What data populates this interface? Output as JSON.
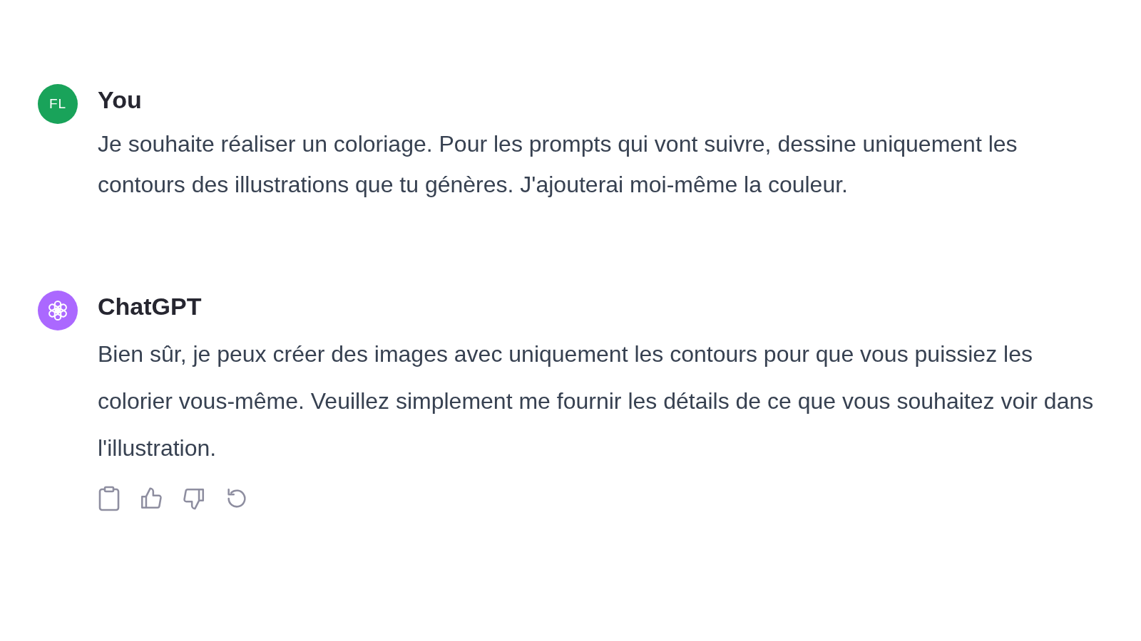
{
  "messages": [
    {
      "kind": "user",
      "author": "You",
      "avatar_text": "FL",
      "text": "Je souhaite réaliser un coloriage. Pour les prompts qui vont suivre, dessine uniquement les contours des illustrations que tu génères. J'ajouterai moi-même la couleur."
    },
    {
      "kind": "assistant",
      "author": "ChatGPT",
      "text": "Bien sûr, je peux créer des images avec uniquement les contours pour que vous puissiez les colorier vous-même. Veuillez simplement me fournir les détails de ce que vous souhaitez voir dans l'illustration."
    }
  ]
}
